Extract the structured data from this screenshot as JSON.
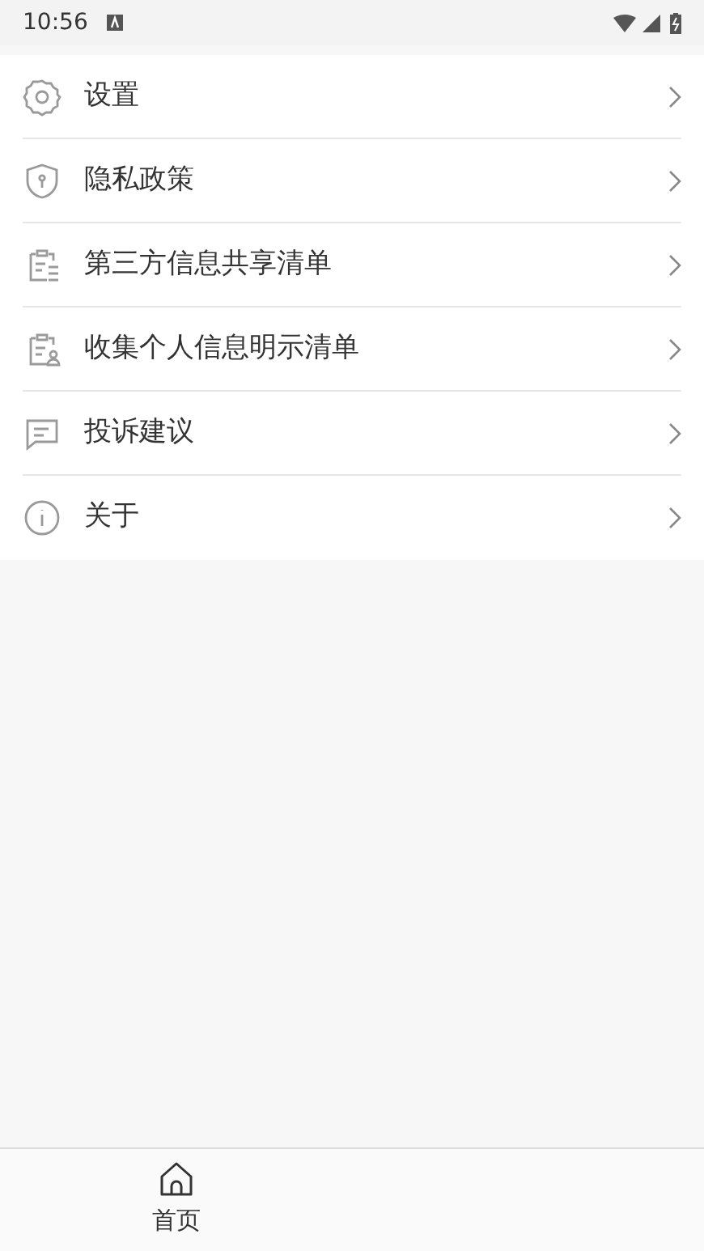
{
  "status_bar": {
    "time": "10:56"
  },
  "menu": [
    {
      "kind": "gear",
      "label": "设置"
    },
    {
      "kind": "shield",
      "label": "隐私政策"
    },
    {
      "kind": "list",
      "label": "第三方信息共享清单"
    },
    {
      "kind": "person-list",
      "label": "收集个人信息明示清单"
    },
    {
      "kind": "chat",
      "label": "投诉建议"
    },
    {
      "kind": "info",
      "label": "关于"
    }
  ],
  "bottom_nav": [
    {
      "label": "首页",
      "selected": true
    }
  ]
}
